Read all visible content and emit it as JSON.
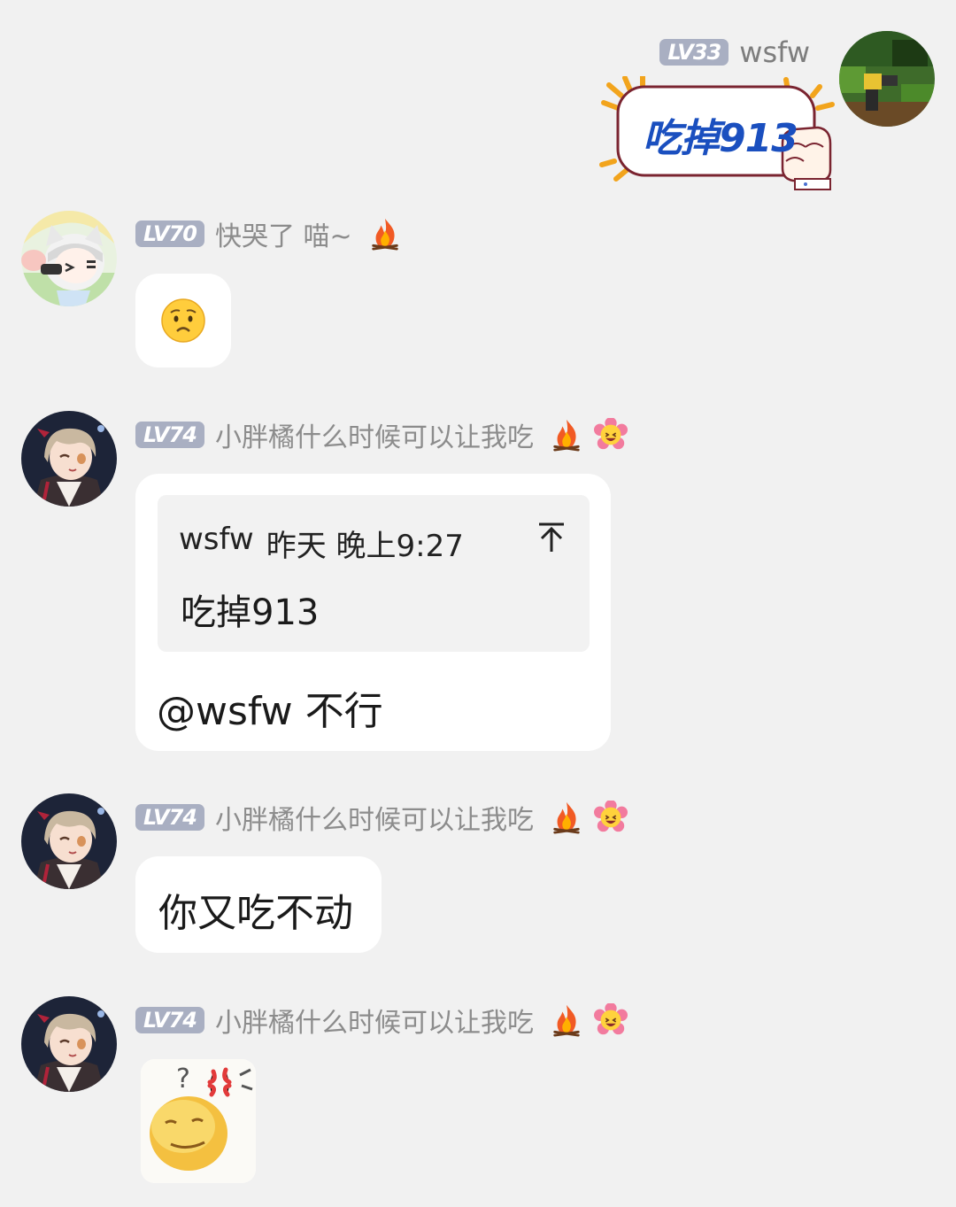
{
  "messages": [
    {
      "sender": "wsfw",
      "level": "LV33",
      "sticker_text": "吃掉913"
    },
    {
      "sender": "快哭了 喵~",
      "level": "LV70",
      "badge_icon": "fire-icon",
      "content_icon": "worried-face-emoji"
    },
    {
      "sender": "小胖橘什么时候可以让我吃",
      "level": "LV74",
      "badge_icons": [
        "fire-icon",
        "flower-smile-icon"
      ],
      "quote": {
        "author": "wsfw",
        "time": "昨天 晚上9:27",
        "text": "吃掉913",
        "jump_icon": "jump-to-original-icon"
      },
      "text": "@wsfw 不行"
    },
    {
      "sender": "小胖橘什么时候可以让我吃",
      "level": "LV74",
      "badge_icons": [
        "fire-icon",
        "flower-smile-icon"
      ],
      "text": "你又吃不动"
    },
    {
      "sender": "小胖橘什么时候可以让我吃",
      "level": "LV74",
      "badge_icons": [
        "fire-icon",
        "flower-smile-icon"
      ],
      "content_icon": "confused-angry-face-sticker"
    }
  ]
}
